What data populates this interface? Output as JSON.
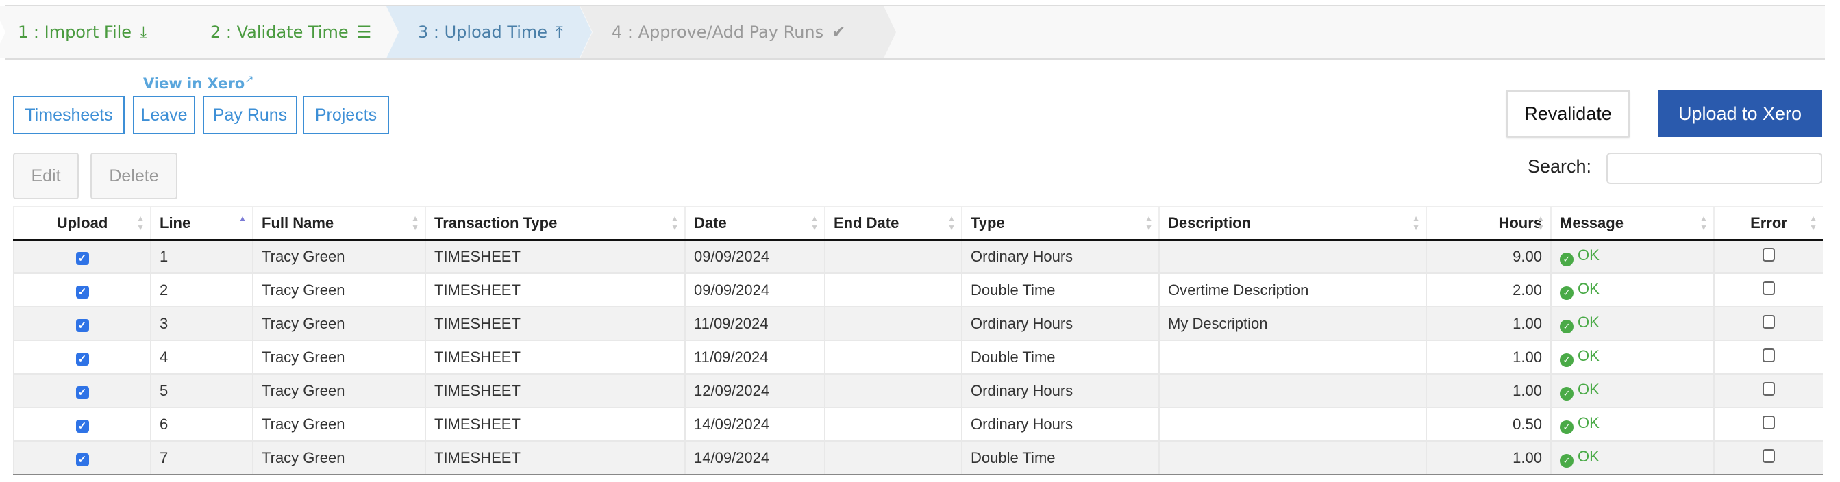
{
  "stepper": [
    {
      "label": "1 : Import File",
      "icon": "download-icon",
      "state": "done"
    },
    {
      "label": "2 : Validate Time",
      "icon": "list-icon",
      "state": "done"
    },
    {
      "label": "3 : Upload Time",
      "icon": "upload-icon",
      "state": "active"
    },
    {
      "label": "4 : Approve/Add Pay Runs",
      "icon": "check-circle-icon",
      "state": "pending"
    }
  ],
  "xero": {
    "view_label": "View in Xero",
    "links": [
      "Timesheets",
      "Leave",
      "Pay Runs",
      "Projects"
    ]
  },
  "actions": {
    "revalidate": "Revalidate",
    "upload": "Upload to Xero",
    "edit": "Edit",
    "delete": "Delete",
    "search_label": "Search:",
    "search_value": ""
  },
  "colors": {
    "primary": "#2a5aad",
    "link": "#3d8fd6",
    "done": "#4a9b3f",
    "ok": "#4aaa47"
  },
  "table": {
    "columns": [
      "Upload",
      "Line",
      "Full Name",
      "Transaction Type",
      "Date",
      "End Date",
      "Type",
      "Description",
      "Hours",
      "Message",
      "Error"
    ],
    "sorted_column": "Line",
    "sort_direction": "ascending",
    "rows": [
      {
        "upload": true,
        "line": "1",
        "name": "Tracy Green",
        "ttype": "TIMESHEET",
        "date": "09/09/2024",
        "end": "",
        "type": "Ordinary Hours",
        "desc": "",
        "hours": "9.00",
        "msg": "OK",
        "error": false
      },
      {
        "upload": true,
        "line": "2",
        "name": "Tracy Green",
        "ttype": "TIMESHEET",
        "date": "09/09/2024",
        "end": "",
        "type": "Double Time",
        "desc": "Overtime Description",
        "hours": "2.00",
        "msg": "OK",
        "error": false
      },
      {
        "upload": true,
        "line": "3",
        "name": "Tracy Green",
        "ttype": "TIMESHEET",
        "date": "11/09/2024",
        "end": "",
        "type": "Ordinary Hours",
        "desc": "My Description",
        "hours": "1.00",
        "msg": "OK",
        "error": false
      },
      {
        "upload": true,
        "line": "4",
        "name": "Tracy Green",
        "ttype": "TIMESHEET",
        "date": "11/09/2024",
        "end": "",
        "type": "Double Time",
        "desc": "",
        "hours": "1.00",
        "msg": "OK",
        "error": false
      },
      {
        "upload": true,
        "line": "5",
        "name": "Tracy Green",
        "ttype": "TIMESHEET",
        "date": "12/09/2024",
        "end": "",
        "type": "Ordinary Hours",
        "desc": "",
        "hours": "1.00",
        "msg": "OK",
        "error": false
      },
      {
        "upload": true,
        "line": "6",
        "name": "Tracy Green",
        "ttype": "TIMESHEET",
        "date": "14/09/2024",
        "end": "",
        "type": "Ordinary Hours",
        "desc": "",
        "hours": "0.50",
        "msg": "OK",
        "error": false
      },
      {
        "upload": true,
        "line": "7",
        "name": "Tracy Green",
        "ttype": "TIMESHEET",
        "date": "14/09/2024",
        "end": "",
        "type": "Double Time",
        "desc": "",
        "hours": "1.00",
        "msg": "OK",
        "error": false
      }
    ]
  }
}
